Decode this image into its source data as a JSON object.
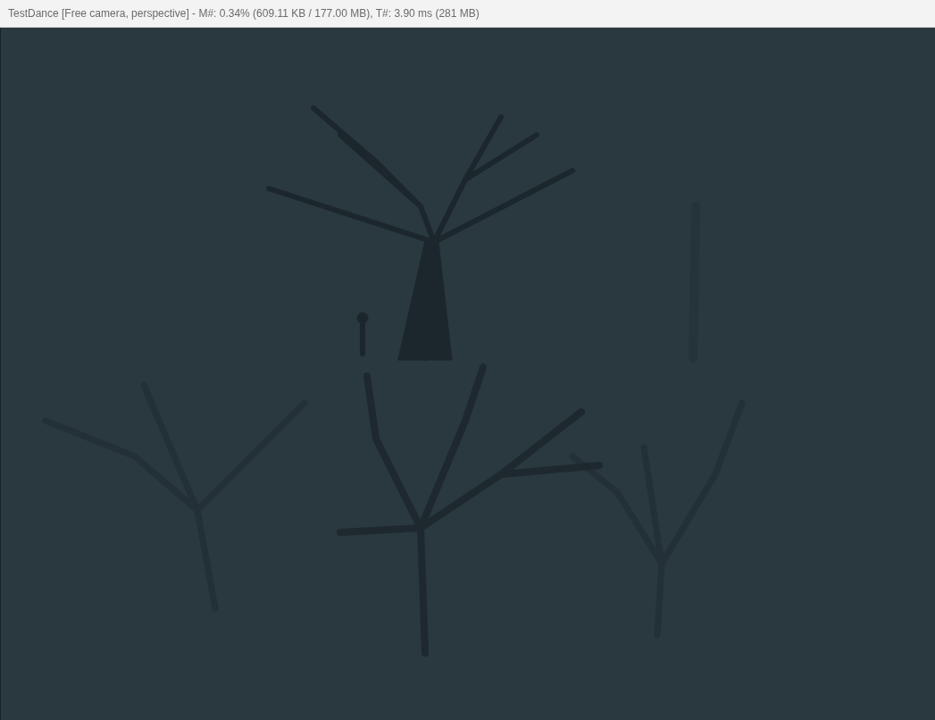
{
  "window": {
    "title": "TestDance [Free camera, perspective] - M#: 0.34% (609.11 KB / 177.00 MB), T#: 3.90 ms (281 MB)"
  }
}
